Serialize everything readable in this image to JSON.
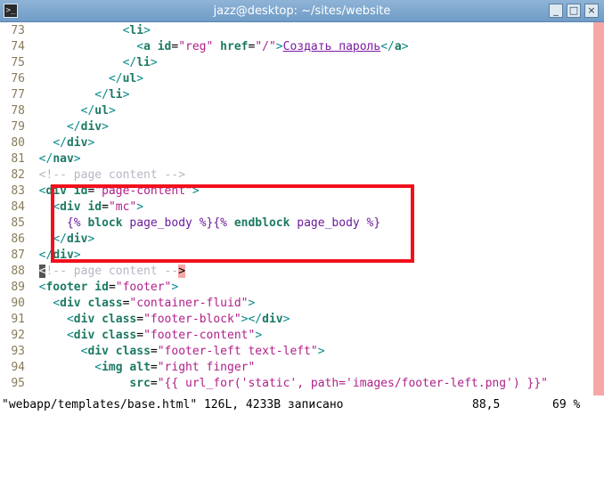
{
  "window": {
    "title": "jazz@desktop: ~/sites/website",
    "icon": "terminal-icon",
    "buttons": {
      "minimize": "_",
      "maximize": "□",
      "close": "×"
    }
  },
  "lines": [
    {
      "n": "73",
      "parts": [
        {
          "t": "            ",
          "c": ""
        },
        {
          "t": "<",
          "c": "tag"
        },
        {
          "t": "li",
          "c": "tagname"
        },
        {
          "t": ">",
          "c": "tag"
        }
      ]
    },
    {
      "n": "74",
      "parts": [
        {
          "t": "              ",
          "c": ""
        },
        {
          "t": "<",
          "c": "tag"
        },
        {
          "t": "a",
          "c": "tagname"
        },
        {
          "t": " ",
          "c": ""
        },
        {
          "t": "id",
          "c": "attr"
        },
        {
          "t": "=",
          "c": "eq"
        },
        {
          "t": "\"reg\"",
          "c": "str"
        },
        {
          "t": " ",
          "c": ""
        },
        {
          "t": "href",
          "c": "attr"
        },
        {
          "t": "=",
          "c": "eq"
        },
        {
          "t": "\"/\"",
          "c": "str"
        },
        {
          "t": ">",
          "c": "tag"
        },
        {
          "t": "Создать пароль",
          "c": "link"
        },
        {
          "t": "</",
          "c": "tag"
        },
        {
          "t": "a",
          "c": "tagname"
        },
        {
          "t": ">",
          "c": "tag"
        }
      ]
    },
    {
      "n": "75",
      "parts": [
        {
          "t": "            ",
          "c": ""
        },
        {
          "t": "</",
          "c": "tag"
        },
        {
          "t": "li",
          "c": "tagname"
        },
        {
          "t": ">",
          "c": "tag"
        }
      ]
    },
    {
      "n": "76",
      "parts": [
        {
          "t": "          ",
          "c": ""
        },
        {
          "t": "</",
          "c": "tag"
        },
        {
          "t": "ul",
          "c": "tagname"
        },
        {
          "t": ">",
          "c": "tag"
        }
      ]
    },
    {
      "n": "77",
      "parts": [
        {
          "t": "        ",
          "c": ""
        },
        {
          "t": "</",
          "c": "tag"
        },
        {
          "t": "li",
          "c": "tagname"
        },
        {
          "t": ">",
          "c": "tag"
        }
      ]
    },
    {
      "n": "78",
      "parts": [
        {
          "t": "      ",
          "c": ""
        },
        {
          "t": "</",
          "c": "tag"
        },
        {
          "t": "ul",
          "c": "tagname"
        },
        {
          "t": ">",
          "c": "tag"
        }
      ]
    },
    {
      "n": "79",
      "parts": [
        {
          "t": "    ",
          "c": ""
        },
        {
          "t": "</",
          "c": "tag"
        },
        {
          "t": "div",
          "c": "tagname"
        },
        {
          "t": ">",
          "c": "tag"
        }
      ]
    },
    {
      "n": "80",
      "parts": [
        {
          "t": "  ",
          "c": ""
        },
        {
          "t": "</",
          "c": "tag"
        },
        {
          "t": "div",
          "c": "tagname"
        },
        {
          "t": ">",
          "c": "tag"
        }
      ]
    },
    {
      "n": "81",
      "parts": [
        {
          "t": "</",
          "c": "tag"
        },
        {
          "t": "nav",
          "c": "tagname"
        },
        {
          "t": ">",
          "c": "tag"
        }
      ]
    },
    {
      "n": "82",
      "parts": [
        {
          "t": "<!-- page content -->",
          "c": "comment"
        }
      ]
    },
    {
      "n": "83",
      "parts": [
        {
          "t": "<",
          "c": "tag"
        },
        {
          "t": "div",
          "c": "tagname"
        },
        {
          "t": " ",
          "c": ""
        },
        {
          "t": "id",
          "c": "attr"
        },
        {
          "t": "=",
          "c": "eq"
        },
        {
          "t": "\"page-content\"",
          "c": "str"
        },
        {
          "t": ">",
          "c": "tag"
        }
      ]
    },
    {
      "n": "84",
      "parts": [
        {
          "t": "  ",
          "c": ""
        },
        {
          "t": "<",
          "c": "tag"
        },
        {
          "t": "div",
          "c": "tagname"
        },
        {
          "t": " ",
          "c": ""
        },
        {
          "t": "id",
          "c": "attr"
        },
        {
          "t": "=",
          "c": "eq"
        },
        {
          "t": "\"mc\"",
          "c": "str"
        },
        {
          "t": ">",
          "c": "tag"
        }
      ]
    },
    {
      "n": "85",
      "parts": [
        {
          "t": "    ",
          "c": ""
        },
        {
          "t": "{%",
          "c": "jinja"
        },
        {
          "t": " ",
          "c": ""
        },
        {
          "t": "block",
          "c": "kw"
        },
        {
          "t": " page_body ",
          "c": "jinja"
        },
        {
          "t": "%}{%",
          "c": "jinja"
        },
        {
          "t": " ",
          "c": ""
        },
        {
          "t": "endblock",
          "c": "kw"
        },
        {
          "t": " page_body ",
          "c": "jinja"
        },
        {
          "t": "%}",
          "c": "jinja"
        }
      ]
    },
    {
      "n": "86",
      "parts": [
        {
          "t": "  ",
          "c": ""
        },
        {
          "t": "</",
          "c": "tag"
        },
        {
          "t": "div",
          "c": "tagname"
        },
        {
          "t": ">",
          "c": "tag"
        }
      ]
    },
    {
      "n": "87",
      "parts": [
        {
          "t": "</",
          "c": "tag"
        },
        {
          "t": "div",
          "c": "tagname"
        },
        {
          "t": ">",
          "c": "tag"
        }
      ]
    },
    {
      "n": "88",
      "parts": [
        {
          "t": "<",
          "c": "cursor"
        },
        {
          "t": "!-- page content --",
          "c": "comment"
        },
        {
          "t": ">",
          "c": "hlbg"
        }
      ]
    },
    {
      "n": "89",
      "parts": [
        {
          "t": "<",
          "c": "tag"
        },
        {
          "t": "footer",
          "c": "tagname"
        },
        {
          "t": " ",
          "c": ""
        },
        {
          "t": "id",
          "c": "attr"
        },
        {
          "t": "=",
          "c": "eq"
        },
        {
          "t": "\"footer\"",
          "c": "str"
        },
        {
          "t": ">",
          "c": "tag"
        }
      ]
    },
    {
      "n": "90",
      "parts": [
        {
          "t": "  ",
          "c": ""
        },
        {
          "t": "<",
          "c": "tag"
        },
        {
          "t": "div",
          "c": "tagname"
        },
        {
          "t": " ",
          "c": ""
        },
        {
          "t": "class",
          "c": "attr"
        },
        {
          "t": "=",
          "c": "eq"
        },
        {
          "t": "\"container-fluid\"",
          "c": "str"
        },
        {
          "t": ">",
          "c": "tag"
        }
      ]
    },
    {
      "n": "91",
      "parts": [
        {
          "t": "    ",
          "c": ""
        },
        {
          "t": "<",
          "c": "tag"
        },
        {
          "t": "div",
          "c": "tagname"
        },
        {
          "t": " ",
          "c": ""
        },
        {
          "t": "class",
          "c": "attr"
        },
        {
          "t": "=",
          "c": "eq"
        },
        {
          "t": "\"footer-block\"",
          "c": "str"
        },
        {
          "t": "></",
          "c": "tag"
        },
        {
          "t": "div",
          "c": "tagname"
        },
        {
          "t": ">",
          "c": "tag"
        }
      ]
    },
    {
      "n": "92",
      "parts": [
        {
          "t": "    ",
          "c": ""
        },
        {
          "t": "<",
          "c": "tag"
        },
        {
          "t": "div",
          "c": "tagname"
        },
        {
          "t": " ",
          "c": ""
        },
        {
          "t": "class",
          "c": "attr"
        },
        {
          "t": "=",
          "c": "eq"
        },
        {
          "t": "\"footer-content\"",
          "c": "str"
        },
        {
          "t": ">",
          "c": "tag"
        }
      ]
    },
    {
      "n": "93",
      "parts": [
        {
          "t": "      ",
          "c": ""
        },
        {
          "t": "<",
          "c": "tag"
        },
        {
          "t": "div",
          "c": "tagname"
        },
        {
          "t": " ",
          "c": ""
        },
        {
          "t": "class",
          "c": "attr"
        },
        {
          "t": "=",
          "c": "eq"
        },
        {
          "t": "\"footer-left text-left\"",
          "c": "str"
        },
        {
          "t": ">",
          "c": "tag"
        }
      ]
    },
    {
      "n": "94",
      "parts": [
        {
          "t": "        ",
          "c": ""
        },
        {
          "t": "<",
          "c": "tag"
        },
        {
          "t": "img",
          "c": "tagname"
        },
        {
          "t": " ",
          "c": ""
        },
        {
          "t": "alt",
          "c": "attr"
        },
        {
          "t": "=",
          "c": "eq"
        },
        {
          "t": "\"right finger\"",
          "c": "str"
        }
      ]
    },
    {
      "n": "95",
      "parts": [
        {
          "t": "             ",
          "c": ""
        },
        {
          "t": "src",
          "c": "attr"
        },
        {
          "t": "=",
          "c": "eq"
        },
        {
          "t": "\"{{ url_for('static', path='images/footer-left.png') }}\"",
          "c": "str"
        }
      ]
    }
  ],
  "status": {
    "file": "\"webapp/templates/base.html\" 126L, 4233B записано",
    "position": "88,5",
    "percent": "69 %"
  }
}
